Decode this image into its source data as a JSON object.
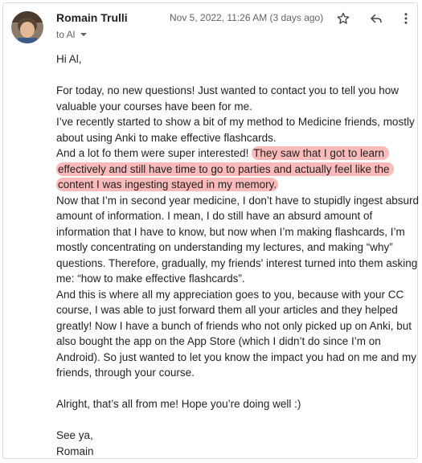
{
  "email": {
    "sender_name": "Romain Trulli",
    "recipient_line": "to Al",
    "date": "Nov 5, 2022, 11:26 AM (3 days ago)",
    "greeting": "Hi Al,",
    "p1": "For today, no new questions! Just wanted to contact you to tell you how valuable your courses have been for me.",
    "p2": "I’ve recently started to show a bit of my method to Medicine friends, mostly about using Anki to make effective flashcards.",
    "p3_before": "And a lot fo them were super interested! ",
    "p3_highlight": "They saw that I got to learn effectively and still have time to go to parties and actually feel like the content I was ingesting stayed in my memory.",
    "p4": "Now that I’m in second year medicine, I don’t have to stupidly ingest absurd amount of information. I mean, I do still have an absurd amount of information that I have to know, but now when I’m making flashcards, I’m mostly concentrating on understanding my lectures, and making “why” questions. Therefore, gradually, my friends' interest turned into them asking me: “how to make effective flashcards”.",
    "p5": "And this is where all my appreciation goes to you, because with your CC course, I was able to just forward them all your articles and they helped greatly! Now I have a bunch of friends who not only picked up on Anki, but also bought the app on the App Store (which I didn’t do since I’m on Android). So just wanted to let you know the impact you had on me and my friends, through your course.",
    "closing": "Alright, that’s all from me! Hope you’re doing well :)",
    "signoff": "See ya,",
    "signature": "Romain"
  },
  "icons": {
    "star": "star-icon",
    "reply": "reply-icon",
    "more": "more-vert-icon",
    "dropdown": "chevron-down-icon"
  },
  "colors": {
    "highlight": "#f58c8c",
    "text": "#222222",
    "muted": "#5f6368"
  }
}
